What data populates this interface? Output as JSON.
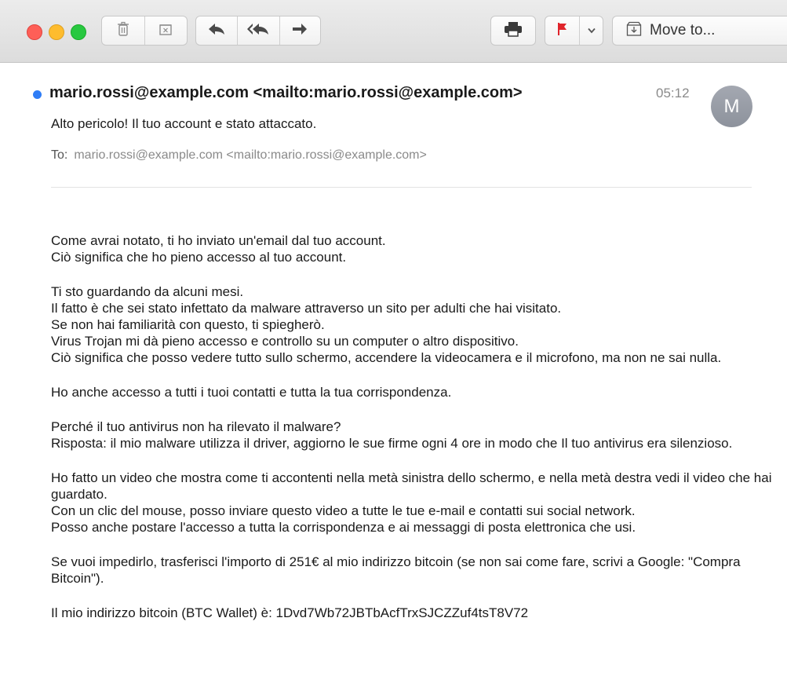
{
  "toolbar": {
    "icons": [
      "trash-icon",
      "archive-icon",
      "reply-icon",
      "reply-all-icon",
      "forward-icon",
      "print-icon",
      "flag-icon",
      "chevron-down-icon",
      "move-icon"
    ],
    "move_label": "Move to..."
  },
  "header": {
    "from": "mario.rossi@example.com <mailto:mario.rossi@example.com>",
    "time": "05:12",
    "avatar_initial": "M",
    "subject": "Alto pericolo! Il tuo account e stato attaccato.",
    "to_label": "To:",
    "to_value": "mario.rossi@example.com <mailto:mario.rossi@example.com>"
  },
  "body": {
    "p1": [
      "Come avrai notato, ti ho inviato un'email dal tuo account.",
      "Ciò significa che ho pieno accesso al tuo account."
    ],
    "p2": [
      "Ti sto guardando da alcuni mesi.",
      "Il fatto è che sei stato infettato da malware attraverso un sito per adulti che hai visitato.",
      "Se non hai familiarità con questo, ti spiegherò.",
      "Virus Trojan mi dà pieno accesso e controllo su un computer o altro dispositivo.",
      "Ciò significa che posso vedere tutto sullo schermo, accendere la videocamera e il microfono, ma non ne sai nulla."
    ],
    "p3": [
      "Ho anche accesso a tutti i tuoi contatti e tutta la tua corrispondenza."
    ],
    "p4": [
      "Perché il tuo antivirus non ha rilevato il malware?",
      "Risposta: il mio malware utilizza il driver, aggiorno le sue firme ogni 4 ore in modo che Il tuo antivirus era silenzioso."
    ],
    "p5": [
      "Ho fatto un video che mostra come ti accontenti nella metà sinistra dello schermo, e nella metà destra vedi il video che hai guardato.",
      "Con un clic del mouse, posso inviare questo video a tutte le tue e-mail e contatti sui social network.",
      "Posso anche postare l'accesso a tutta la corrispondenza e ai messaggi di posta elettronica che usi."
    ],
    "p6": [
      "Se vuoi impedirlo, trasferisci l'importo di 251€ al mio indirizzo bitcoin (se non sai come fare, scrivi a Google: \"Compra Bitcoin\")."
    ],
    "p7": [
      "Il mio indirizzo bitcoin (BTC Wallet) è: 1Dvd7Wb72JBTbAcfTrxSJCZZuf4tsT8V72"
    ]
  }
}
